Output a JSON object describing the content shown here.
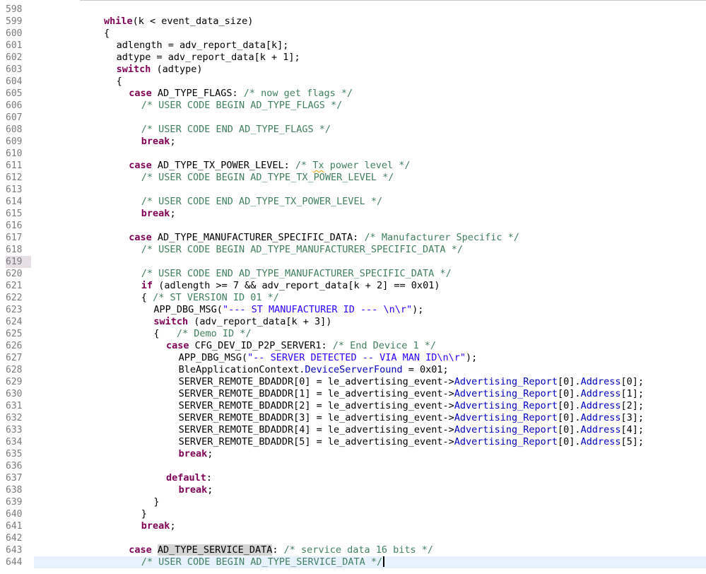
{
  "editor": {
    "lines": [
      {
        "num": "598",
        "indent": 0,
        "tokens": []
      },
      {
        "num": "599",
        "indent": 0,
        "tokens": [
          {
            "t": "kw",
            "v": "while"
          },
          {
            "t": "p",
            "v": "(k < event_data_size)"
          }
        ]
      },
      {
        "num": "600",
        "indent": 0,
        "tokens": [
          {
            "t": "p",
            "v": "{"
          }
        ]
      },
      {
        "num": "601",
        "indent": 1,
        "tokens": [
          {
            "t": "p",
            "v": "adlength = adv_report_data[k];"
          }
        ]
      },
      {
        "num": "602",
        "indent": 1,
        "tokens": [
          {
            "t": "p",
            "v": "adtype = adv_report_data[k + 1];"
          }
        ]
      },
      {
        "num": "603",
        "indent": 1,
        "tokens": [
          {
            "t": "kw",
            "v": "switch"
          },
          {
            "t": "p",
            "v": " (adtype)"
          }
        ]
      },
      {
        "num": "604",
        "indent": 1,
        "tokens": [
          {
            "t": "p",
            "v": "{"
          }
        ]
      },
      {
        "num": "605",
        "indent": 2,
        "tokens": [
          {
            "t": "kw",
            "v": "case"
          },
          {
            "t": "p",
            "v": " AD_TYPE_FLAGS: "
          },
          {
            "t": "cm",
            "v": "/* now get flags */"
          }
        ]
      },
      {
        "num": "606",
        "indent": 3,
        "tokens": [
          {
            "t": "cm",
            "v": "/* USER CODE BEGIN AD_TYPE_FLAGS */"
          }
        ]
      },
      {
        "num": "607",
        "indent": 0,
        "tokens": []
      },
      {
        "num": "608",
        "indent": 3,
        "tokens": [
          {
            "t": "cm",
            "v": "/* USER CODE END AD_TYPE_FLAGS */"
          }
        ]
      },
      {
        "num": "609",
        "indent": 3,
        "tokens": [
          {
            "t": "kw",
            "v": "break"
          },
          {
            "t": "p",
            "v": ";"
          }
        ]
      },
      {
        "num": "610",
        "indent": 0,
        "tokens": []
      },
      {
        "num": "611",
        "indent": 2,
        "tokens": [
          {
            "t": "kw",
            "v": "case"
          },
          {
            "t": "p",
            "v": " AD_TYPE_TX_POWER_LEVEL: "
          },
          {
            "t": "cm",
            "v": "/* "
          },
          {
            "t": "cmsq",
            "v": "Tx"
          },
          {
            "t": "cm",
            "v": " power level */"
          }
        ]
      },
      {
        "num": "612",
        "indent": 3,
        "tokens": [
          {
            "t": "cm",
            "v": "/* USER CODE BEGIN AD_TYPE_TX_POWER_LEVEL */"
          }
        ]
      },
      {
        "num": "613",
        "indent": 0,
        "tokens": []
      },
      {
        "num": "614",
        "indent": 3,
        "tokens": [
          {
            "t": "cm",
            "v": "/* USER CODE END AD_TYPE_TX_POWER_LEVEL */"
          }
        ]
      },
      {
        "num": "615",
        "indent": 3,
        "tokens": [
          {
            "t": "kw",
            "v": "break"
          },
          {
            "t": "p",
            "v": ";"
          }
        ]
      },
      {
        "num": "616",
        "indent": 0,
        "tokens": []
      },
      {
        "num": "617",
        "indent": 2,
        "tokens": [
          {
            "t": "kw",
            "v": "case"
          },
          {
            "t": "p",
            "v": " AD_TYPE_MANUFACTURER_SPECIFIC_DATA: "
          },
          {
            "t": "cm",
            "v": "/* Manufacturer Specific */"
          }
        ]
      },
      {
        "num": "618",
        "indent": 3,
        "tokens": [
          {
            "t": "cm",
            "v": "/* USER CODE BEGIN AD_TYPE_MANUFACTURER_SPECIFIC_DATA */"
          }
        ]
      },
      {
        "num": "619",
        "indent": 0,
        "tokens": [],
        "gutter_highlight": true
      },
      {
        "num": "620",
        "indent": 3,
        "tokens": [
          {
            "t": "cm",
            "v": "/* USER CODE END AD_TYPE_MANUFACTURER_SPECIFIC_DATA */"
          }
        ]
      },
      {
        "num": "621",
        "indent": 3,
        "tokens": [
          {
            "t": "kw",
            "v": "if"
          },
          {
            "t": "p",
            "v": " (adlength >= 7 && adv_report_data[k + 2] == 0x01)"
          }
        ]
      },
      {
        "num": "622",
        "indent": 3,
        "tokens": [
          {
            "t": "p",
            "v": "{ "
          },
          {
            "t": "cm",
            "v": "/* ST VERSION ID 01 */"
          }
        ]
      },
      {
        "num": "623",
        "indent": 4,
        "tokens": [
          {
            "t": "p",
            "v": "APP_DBG_MSG("
          },
          {
            "t": "str",
            "v": "\"--- ST MANUFACTURER ID --- \\n\\r\""
          },
          {
            "t": "p",
            "v": ");"
          }
        ]
      },
      {
        "num": "624",
        "indent": 4,
        "tokens": [
          {
            "t": "kw",
            "v": "switch"
          },
          {
            "t": "p",
            "v": " (adv_report_data[k + 3])"
          }
        ]
      },
      {
        "num": "625",
        "indent": 4,
        "tokens": [
          {
            "t": "p",
            "v": "{   "
          },
          {
            "t": "cm",
            "v": "/* Demo ID */"
          }
        ]
      },
      {
        "num": "626",
        "indent": 5,
        "tokens": [
          {
            "t": "kw",
            "v": "case"
          },
          {
            "t": "p",
            "v": " CFG_DEV_ID_P2P_SERVER1: "
          },
          {
            "t": "cm",
            "v": "/* End Device 1 */"
          }
        ]
      },
      {
        "num": "627",
        "indent": 6,
        "tokens": [
          {
            "t": "p",
            "v": "APP_DBG_MSG("
          },
          {
            "t": "str",
            "v": "\"-- SERVER DETECTED -- VIA MAN ID\\n\\r\""
          },
          {
            "t": "p",
            "v": ");"
          }
        ]
      },
      {
        "num": "628",
        "indent": 6,
        "tokens": [
          {
            "t": "p",
            "v": "BleApplicationContext."
          },
          {
            "t": "fld",
            "v": "DeviceServerFound"
          },
          {
            "t": "p",
            "v": " = 0x01;"
          }
        ]
      },
      {
        "num": "629",
        "indent": 6,
        "tokens": [
          {
            "t": "p",
            "v": "SERVER_REMOTE_BDADDR[0] = le_advertising_event->"
          },
          {
            "t": "fld",
            "v": "Advertising_Report"
          },
          {
            "t": "p",
            "v": "[0]."
          },
          {
            "t": "fld",
            "v": "Address"
          },
          {
            "t": "p",
            "v": "[0];"
          }
        ]
      },
      {
        "num": "630",
        "indent": 6,
        "tokens": [
          {
            "t": "p",
            "v": "SERVER_REMOTE_BDADDR[1] = le_advertising_event->"
          },
          {
            "t": "fld",
            "v": "Advertising_Report"
          },
          {
            "t": "p",
            "v": "[0]."
          },
          {
            "t": "fld",
            "v": "Address"
          },
          {
            "t": "p",
            "v": "[1];"
          }
        ]
      },
      {
        "num": "631",
        "indent": 6,
        "tokens": [
          {
            "t": "p",
            "v": "SERVER_REMOTE_BDADDR[2] = le_advertising_event->"
          },
          {
            "t": "fld",
            "v": "Advertising_Report"
          },
          {
            "t": "p",
            "v": "[0]."
          },
          {
            "t": "fld",
            "v": "Address"
          },
          {
            "t": "p",
            "v": "[2];"
          }
        ]
      },
      {
        "num": "632",
        "indent": 6,
        "tokens": [
          {
            "t": "p",
            "v": "SERVER_REMOTE_BDADDR[3] = le_advertising_event->"
          },
          {
            "t": "fld",
            "v": "Advertising_Report"
          },
          {
            "t": "p",
            "v": "[0]."
          },
          {
            "t": "fld",
            "v": "Address"
          },
          {
            "t": "p",
            "v": "[3];"
          }
        ]
      },
      {
        "num": "633",
        "indent": 6,
        "tokens": [
          {
            "t": "p",
            "v": "SERVER_REMOTE_BDADDR[4] = le_advertising_event->"
          },
          {
            "t": "fld",
            "v": "Advertising_Report"
          },
          {
            "t": "p",
            "v": "[0]."
          },
          {
            "t": "fld",
            "v": "Address"
          },
          {
            "t": "p",
            "v": "[4];"
          }
        ]
      },
      {
        "num": "634",
        "indent": 6,
        "tokens": [
          {
            "t": "p",
            "v": "SERVER_REMOTE_BDADDR[5] = le_advertising_event->"
          },
          {
            "t": "fld",
            "v": "Advertising_Report"
          },
          {
            "t": "p",
            "v": "[0]."
          },
          {
            "t": "fld",
            "v": "Address"
          },
          {
            "t": "p",
            "v": "[5];"
          }
        ]
      },
      {
        "num": "635",
        "indent": 6,
        "tokens": [
          {
            "t": "kw",
            "v": "break"
          },
          {
            "t": "p",
            "v": ";"
          }
        ]
      },
      {
        "num": "636",
        "indent": 0,
        "tokens": []
      },
      {
        "num": "637",
        "indent": 5,
        "tokens": [
          {
            "t": "kw",
            "v": "default"
          },
          {
            "t": "p",
            "v": ":"
          }
        ]
      },
      {
        "num": "638",
        "indent": 6,
        "tokens": [
          {
            "t": "kw",
            "v": "break"
          },
          {
            "t": "p",
            "v": ";"
          }
        ]
      },
      {
        "num": "639",
        "indent": 4,
        "tokens": [
          {
            "t": "p",
            "v": "}"
          }
        ]
      },
      {
        "num": "640",
        "indent": 3,
        "tokens": [
          {
            "t": "p",
            "v": "}"
          }
        ]
      },
      {
        "num": "641",
        "indent": 3,
        "tokens": [
          {
            "t": "kw",
            "v": "break"
          },
          {
            "t": "p",
            "v": ";"
          }
        ]
      },
      {
        "num": "642",
        "indent": 0,
        "tokens": []
      },
      {
        "num": "643",
        "indent": 2,
        "tokens": [
          {
            "t": "kw",
            "v": "case"
          },
          {
            "t": "p",
            "v": " "
          },
          {
            "t": "sel",
            "v": "AD_TYPE_SERVICE_DATA"
          },
          {
            "t": "p",
            "v": ": "
          },
          {
            "t": "cm",
            "v": "/* service data 16 bits */"
          }
        ]
      },
      {
        "num": "644",
        "indent": 3,
        "tokens": [
          {
            "t": "cm",
            "v": "/* USER CODE BEGIN AD_TYPE_SERVICE_DATA */"
          }
        ],
        "current": true,
        "caret": true
      }
    ]
  }
}
